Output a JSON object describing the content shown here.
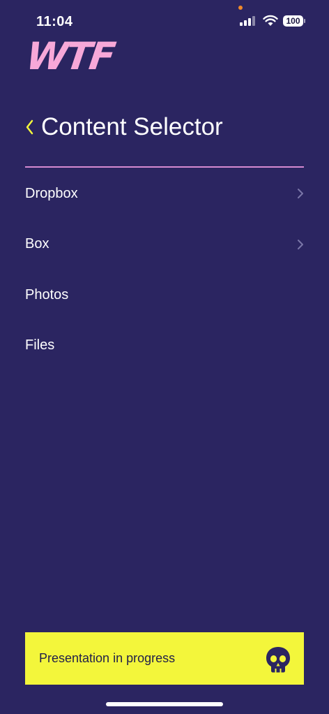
{
  "status_bar": {
    "time": "11:04",
    "battery": "100",
    "icons": [
      "signal-icon",
      "wifi-icon",
      "battery-icon"
    ]
  },
  "logo": {
    "text": "WTF"
  },
  "header": {
    "title": "Content Selector",
    "back_icon": "chevron-left-icon"
  },
  "menu": {
    "items": [
      {
        "label": "Dropbox",
        "has_chevron": true
      },
      {
        "label": "Box",
        "has_chevron": true
      },
      {
        "label": "Photos",
        "has_chevron": false
      },
      {
        "label": "Files",
        "has_chevron": false
      }
    ]
  },
  "banner": {
    "text": "Presentation in progress",
    "icon": "skull-icon"
  },
  "colors": {
    "background": "#2b2561",
    "accent_yellow": "#f3f63b",
    "logo_pink": "#f7a8d8",
    "divider_pink": "#d68ad2"
  }
}
